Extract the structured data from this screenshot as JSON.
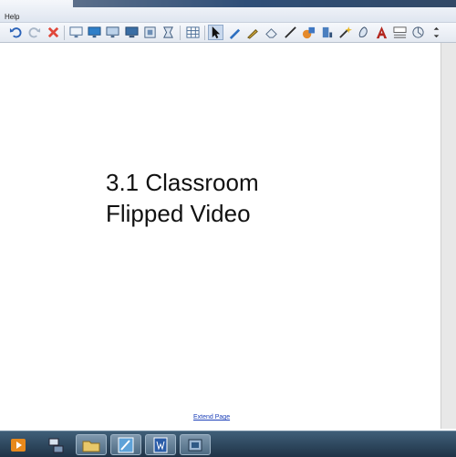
{
  "menubar": {
    "help_label": "Help"
  },
  "toolbar": {
    "buttons": [
      {
        "icon": "undo-icon"
      },
      {
        "icon": "redo-icon"
      },
      {
        "icon": "delete-icon"
      },
      {
        "icon": "screen-shade-icon"
      },
      {
        "icon": "display-icon"
      },
      {
        "icon": "monitor-icon"
      },
      {
        "icon": "presentation-icon"
      },
      {
        "icon": "capture-icon"
      },
      {
        "icon": "crop-icon"
      },
      {
        "icon": "table-icon"
      },
      {
        "icon": "select-pointer-icon"
      },
      {
        "icon": "pen-icon"
      },
      {
        "icon": "creative-pen-icon"
      },
      {
        "icon": "eraser-icon"
      },
      {
        "icon": "line-icon"
      },
      {
        "icon": "shape-icon"
      },
      {
        "icon": "fill-icon"
      },
      {
        "icon": "magic-pen-icon"
      },
      {
        "icon": "properties-icon"
      },
      {
        "icon": "text-icon"
      },
      {
        "icon": "font-icon"
      },
      {
        "icon": "measure-icon"
      },
      {
        "icon": "more-icon"
      }
    ]
  },
  "slide": {
    "title_line1": "3.1 Classroom",
    "title_line2": "Flipped Video"
  },
  "footer": {
    "extend_page_label": "Extend Page"
  },
  "taskbar": {
    "items": [
      {
        "icon": "media-player-icon"
      },
      {
        "icon": "network-icon"
      },
      {
        "icon": "folder-icon"
      },
      {
        "icon": "notebook-app-icon"
      },
      {
        "icon": "word-icon"
      },
      {
        "icon": "tools-icon"
      }
    ]
  }
}
